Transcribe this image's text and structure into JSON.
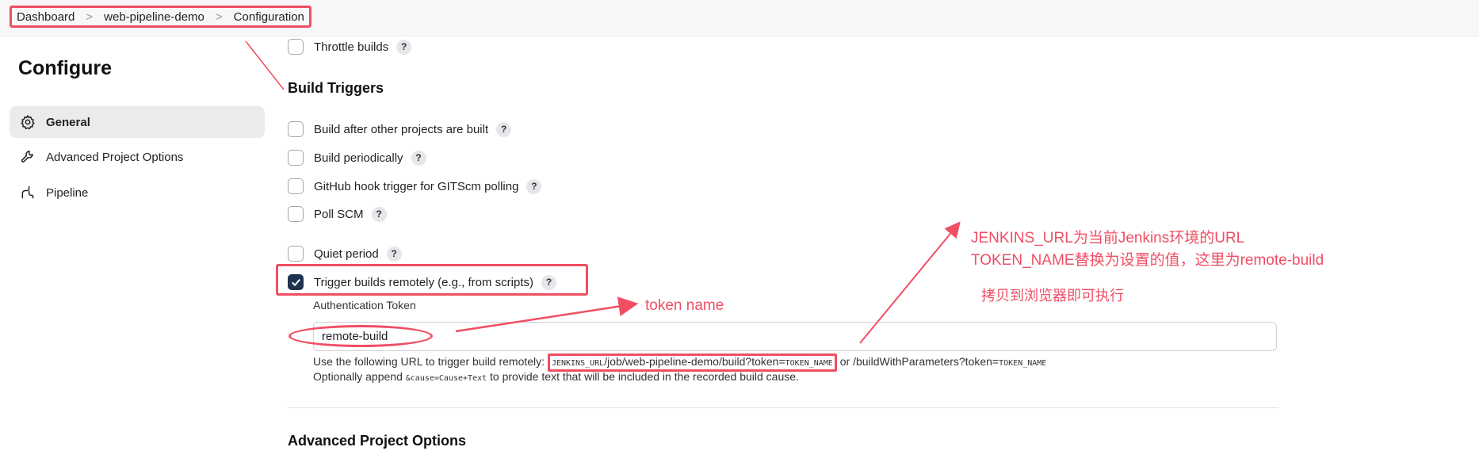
{
  "breadcrumb": {
    "items": [
      "Dashboard",
      "web-pipeline-demo",
      "Configuration"
    ],
    "separator": ">"
  },
  "sidebar": {
    "title": "Configure",
    "items": [
      {
        "label": "General",
        "icon": "gear-icon",
        "active": true
      },
      {
        "label": "Advanced Project Options",
        "icon": "wrench-icon",
        "active": false
      },
      {
        "label": "Pipeline",
        "icon": "pipeline-icon",
        "active": false
      }
    ]
  },
  "main": {
    "throttle_builds": "Throttle builds",
    "build_triggers_title": "Build Triggers",
    "triggers": [
      {
        "label": "Build after other projects are built",
        "checked": false
      },
      {
        "label": "Build periodically",
        "checked": false
      },
      {
        "label": "GitHub hook trigger for GITScm polling",
        "checked": false
      },
      {
        "label": "Poll SCM",
        "checked": false
      },
      {
        "label": "Quiet period",
        "checked": false
      },
      {
        "label": "Trigger builds remotely (e.g., from scripts)",
        "checked": true
      }
    ],
    "help_symbol": "?",
    "auth_token_label": "Authentication Token",
    "auth_token_value": "remote-build",
    "url_help": {
      "prefix": "Use the following URL to trigger build remotely: ",
      "jenkins_url": "JENKINS_URL",
      "path": "/job/web-pipeline-demo/build?token=",
      "token_name": "TOKEN_NAME",
      "or_text": " or /buildWithParameters?token=",
      "token_name_2": "TOKEN_NAME"
    },
    "append_help": {
      "prefix": "Optionally append ",
      "code": "&cause=Cause+Text",
      "suffix": " to provide text that will be included in the recorded build cause."
    },
    "advanced_title": "Advanced Project Options"
  },
  "annotations": {
    "token_name": "token name",
    "line1": "JENKINS_URL为当前Jenkins环境的URL",
    "line2": "TOKEN_NAME替换为设置的值，这里为remote-build",
    "line3": "拷贝到浏览器即可执行"
  },
  "colors": {
    "annotation": "#f04e63",
    "checkbox_checked": "#20324f",
    "active_nav": "#ebebee"
  }
}
